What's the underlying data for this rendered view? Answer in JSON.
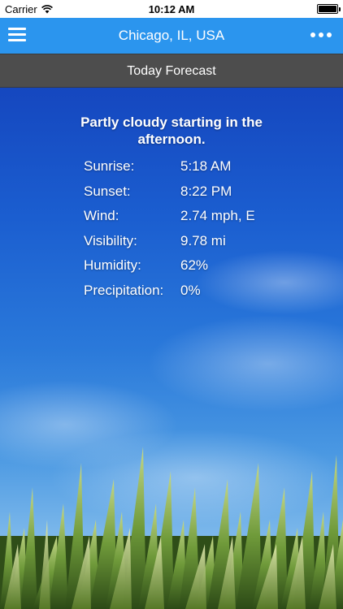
{
  "status_bar": {
    "carrier": "Carrier",
    "time": "10:12 AM"
  },
  "nav": {
    "title": "Chicago, IL, USA",
    "menu_icon": "hamburger-menu-icon",
    "more_icon": "more-dots-icon"
  },
  "section": {
    "title": "Today Forecast"
  },
  "forecast": {
    "summary": "Partly cloudy starting in the afternoon.",
    "rows": [
      {
        "label": "Sunrise:",
        "value": "5:18 AM"
      },
      {
        "label": "Sunset:",
        "value": "8:22 PM"
      },
      {
        "label": "Wind:",
        "value": "2.74 mph, E"
      },
      {
        "label": "Visibility:",
        "value": "9.78 mi"
      },
      {
        "label": "Humidity:",
        "value": "62%"
      },
      {
        "label": "Precipitation:",
        "value": "0%"
      }
    ]
  },
  "colors": {
    "nav_bar": "#2b95ee",
    "section_header": "#4d4d4d",
    "sky_top": "#1547bf",
    "text": "#ffffff"
  }
}
